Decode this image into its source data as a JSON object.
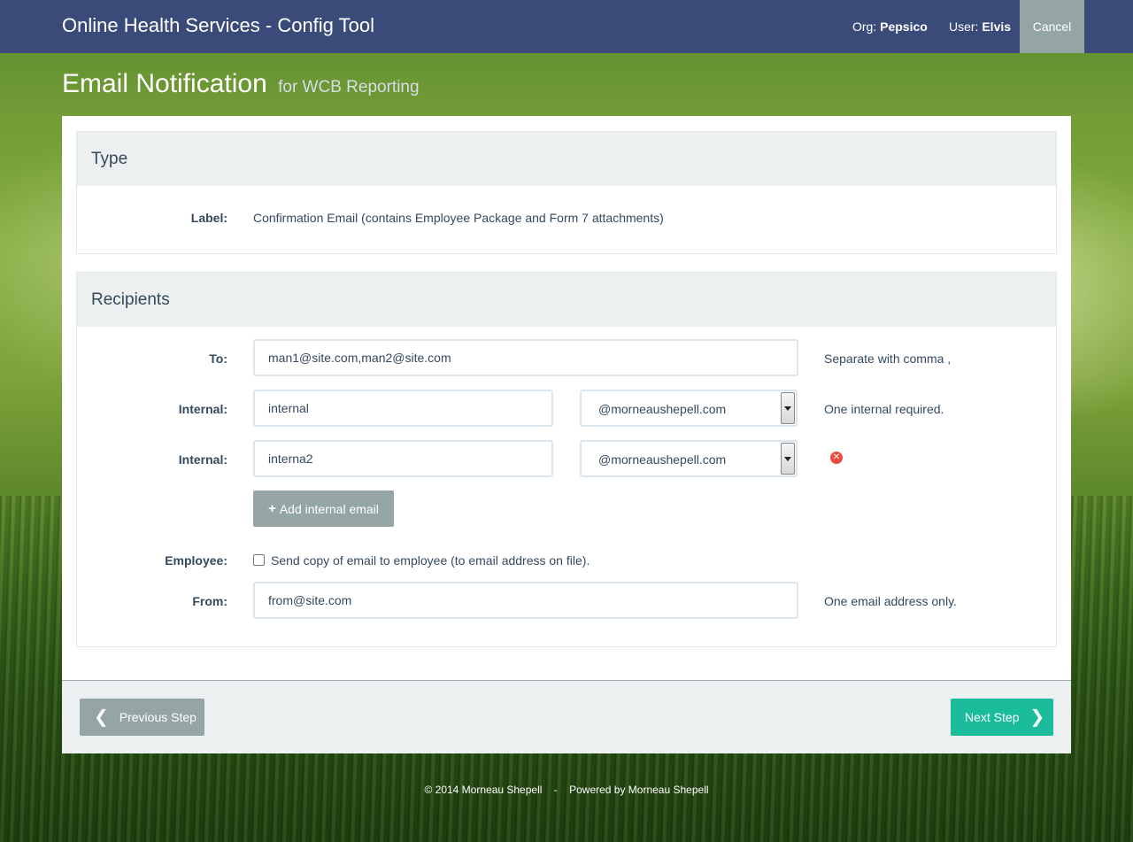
{
  "header": {
    "app_title": "Online Health Services - Config Tool",
    "org_label": "Org:",
    "org_value": "Pepsico",
    "user_label": "User:",
    "user_value": "Elvis",
    "cancel_label": "Cancel"
  },
  "page": {
    "title": "Email Notification",
    "subtitle": "for WCB Reporting"
  },
  "type_panel": {
    "heading": "Type",
    "label_label": "Label:",
    "label_value": "Confirmation Email (contains Employee Package and Form 7 attachments)"
  },
  "recipients_panel": {
    "heading": "Recipients",
    "to_label": "To:",
    "to_value": "man1@site.com,man2@site.com",
    "to_help": "Separate with comma ,",
    "internal_label": "Internal:",
    "internal_rows": [
      {
        "value": "internal",
        "domain": "@morneaushepell.com",
        "help": "One internal required."
      },
      {
        "value": "interna2",
        "domain": "@morneaushepell.com",
        "help": ""
      }
    ],
    "add_internal_label": "Add internal email",
    "employee_label": "Employee:",
    "employee_checkbox_text": "Send copy of email to employee (to email address on file).",
    "employee_checked": false,
    "from_label": "From:",
    "from_value": "from@site.com",
    "from_help": "One email address only."
  },
  "nav": {
    "previous_label": "Previous Step",
    "next_label": "Next Step"
  },
  "footer": {
    "copyright": "© 2014 Morneau Shepell",
    "separator": "-",
    "powered_by": "Powered by Morneau Shepell"
  },
  "colors": {
    "topbar": "#3a4b7a",
    "primary_action": "#1abc9c",
    "secondary_action": "#95a5a6",
    "danger": "#e74c3c"
  },
  "icons": {
    "add": "plus-icon",
    "remove": "remove-circle-icon",
    "previous": "chevron-left-icon",
    "next": "chevron-right-icon",
    "select": "chevron-down-icon"
  }
}
